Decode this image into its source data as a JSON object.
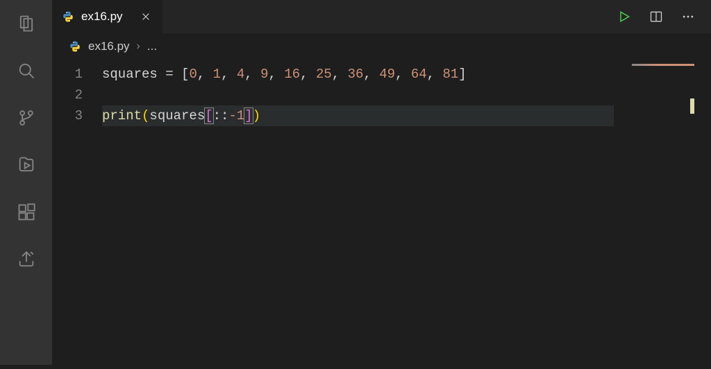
{
  "tab": {
    "label": "ex16.py",
    "icon_name": "python-icon"
  },
  "breadcrumb": {
    "file": "ex16.py",
    "symbol": "..."
  },
  "editor": {
    "line_numbers": [
      "1",
      "2",
      "3"
    ],
    "lines": [
      {
        "tokens": [
          {
            "t": "squares ",
            "c": "tok-default"
          },
          {
            "t": "=",
            "c": "tok-default"
          },
          {
            "t": " [",
            "c": "tok-default"
          },
          {
            "t": "0",
            "c": "tok-number"
          },
          {
            "t": ", ",
            "c": "tok-default"
          },
          {
            "t": "1",
            "c": "tok-number"
          },
          {
            "t": ", ",
            "c": "tok-default"
          },
          {
            "t": "4",
            "c": "tok-number"
          },
          {
            "t": ", ",
            "c": "tok-default"
          },
          {
            "t": "9",
            "c": "tok-number"
          },
          {
            "t": ", ",
            "c": "tok-default"
          },
          {
            "t": "16",
            "c": "tok-number"
          },
          {
            "t": ", ",
            "c": "tok-default"
          },
          {
            "t": "25",
            "c": "tok-number"
          },
          {
            "t": ", ",
            "c": "tok-default"
          },
          {
            "t": "36",
            "c": "tok-number"
          },
          {
            "t": ", ",
            "c": "tok-default"
          },
          {
            "t": "49",
            "c": "tok-number"
          },
          {
            "t": ", ",
            "c": "tok-default"
          },
          {
            "t": "64",
            "c": "tok-number"
          },
          {
            "t": ", ",
            "c": "tok-default"
          },
          {
            "t": "81",
            "c": "tok-number"
          },
          {
            "t": "]",
            "c": "tok-default"
          }
        ],
        "current": false
      },
      {
        "tokens": [],
        "current": false
      },
      {
        "tokens": [
          {
            "t": "print",
            "c": "tok-func"
          },
          {
            "t": "(",
            "c": "tok-bracket"
          },
          {
            "t": "squares",
            "c": "tok-default"
          },
          {
            "t": "[",
            "c": "tok-bracket2 bracket-match"
          },
          {
            "t": "::",
            "c": "tok-default"
          },
          {
            "t": "-1",
            "c": "tok-number"
          },
          {
            "t": "]",
            "c": "tok-bracket2 bracket-match"
          },
          {
            "t": ")",
            "c": "tok-bracket"
          }
        ],
        "current": true
      }
    ]
  },
  "actions": {
    "run": "Run",
    "split": "Split Editor",
    "more": "More Actions"
  }
}
